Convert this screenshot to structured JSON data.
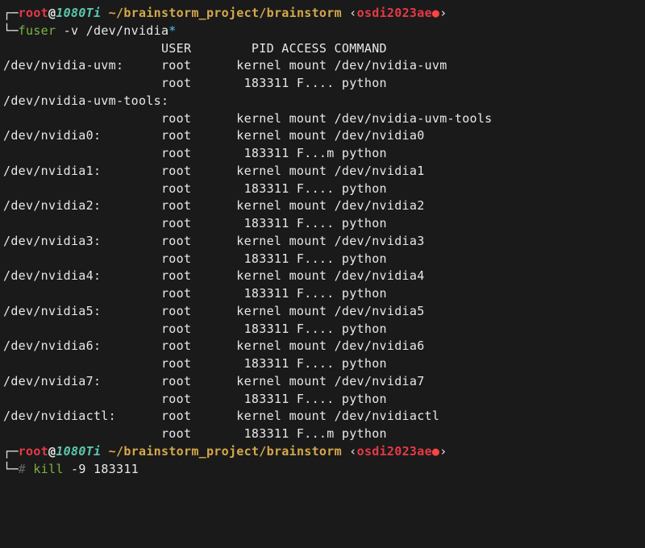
{
  "prompt1": {
    "corner_top": "┌─",
    "corner_bot": "└─",
    "user": "root",
    "at": "@",
    "host": "1080Ti",
    "path": " ~/brainstorm_project/brainstorm ",
    "branch_open": "‹",
    "branch": "osdi2023ae",
    "dot": "●",
    "branch_close": "›"
  },
  "cmd1": {
    "name": "fuser",
    "args": " -v /dev/nvidia",
    "glob": "*"
  },
  "header": "                     USER        PID ACCESS COMMAND",
  "rows": [
    {
      "dev": "/dev/nvidia-uvm:    ",
      "user": " root     ",
      "rest": " kernel mount /dev/nvidia-uvm"
    },
    {
      "dev": "                    ",
      "user": " root     ",
      "rest": "  183311 F.... python"
    },
    {
      "dev": "/dev/nvidia-uvm-tools:",
      "user": "",
      "rest": ""
    },
    {
      "dev": "                    ",
      "user": " root     ",
      "rest": " kernel mount /dev/nvidia-uvm-tools"
    },
    {
      "dev": "/dev/nvidia0:       ",
      "user": " root     ",
      "rest": " kernel mount /dev/nvidia0"
    },
    {
      "dev": "                    ",
      "user": " root     ",
      "rest": "  183311 F...m python"
    },
    {
      "dev": "/dev/nvidia1:       ",
      "user": " root     ",
      "rest": " kernel mount /dev/nvidia1"
    },
    {
      "dev": "                    ",
      "user": " root     ",
      "rest": "  183311 F.... python"
    },
    {
      "dev": "/dev/nvidia2:       ",
      "user": " root     ",
      "rest": " kernel mount /dev/nvidia2"
    },
    {
      "dev": "                    ",
      "user": " root     ",
      "rest": "  183311 F.... python"
    },
    {
      "dev": "/dev/nvidia3:       ",
      "user": " root     ",
      "rest": " kernel mount /dev/nvidia3"
    },
    {
      "dev": "                    ",
      "user": " root     ",
      "rest": "  183311 F.... python"
    },
    {
      "dev": "/dev/nvidia4:       ",
      "user": " root     ",
      "rest": " kernel mount /dev/nvidia4"
    },
    {
      "dev": "                    ",
      "user": " root     ",
      "rest": "  183311 F.... python"
    },
    {
      "dev": "/dev/nvidia5:       ",
      "user": " root     ",
      "rest": " kernel mount /dev/nvidia5"
    },
    {
      "dev": "                    ",
      "user": " root     ",
      "rest": "  183311 F.... python"
    },
    {
      "dev": "/dev/nvidia6:       ",
      "user": " root     ",
      "rest": " kernel mount /dev/nvidia6"
    },
    {
      "dev": "                    ",
      "user": " root     ",
      "rest": "  183311 F.... python"
    },
    {
      "dev": "/dev/nvidia7:       ",
      "user": " root     ",
      "rest": " kernel mount /dev/nvidia7"
    },
    {
      "dev": "                    ",
      "user": " root     ",
      "rest": "  183311 F.... python"
    },
    {
      "dev": "/dev/nvidiactl:     ",
      "user": " root     ",
      "rest": " kernel mount /dev/nvidiactl"
    },
    {
      "dev": "                    ",
      "user": " root     ",
      "rest": "  183311 F...m python"
    }
  ],
  "cmd2": {
    "hash": "# ",
    "name": "kill",
    "args": " -9 183311"
  }
}
